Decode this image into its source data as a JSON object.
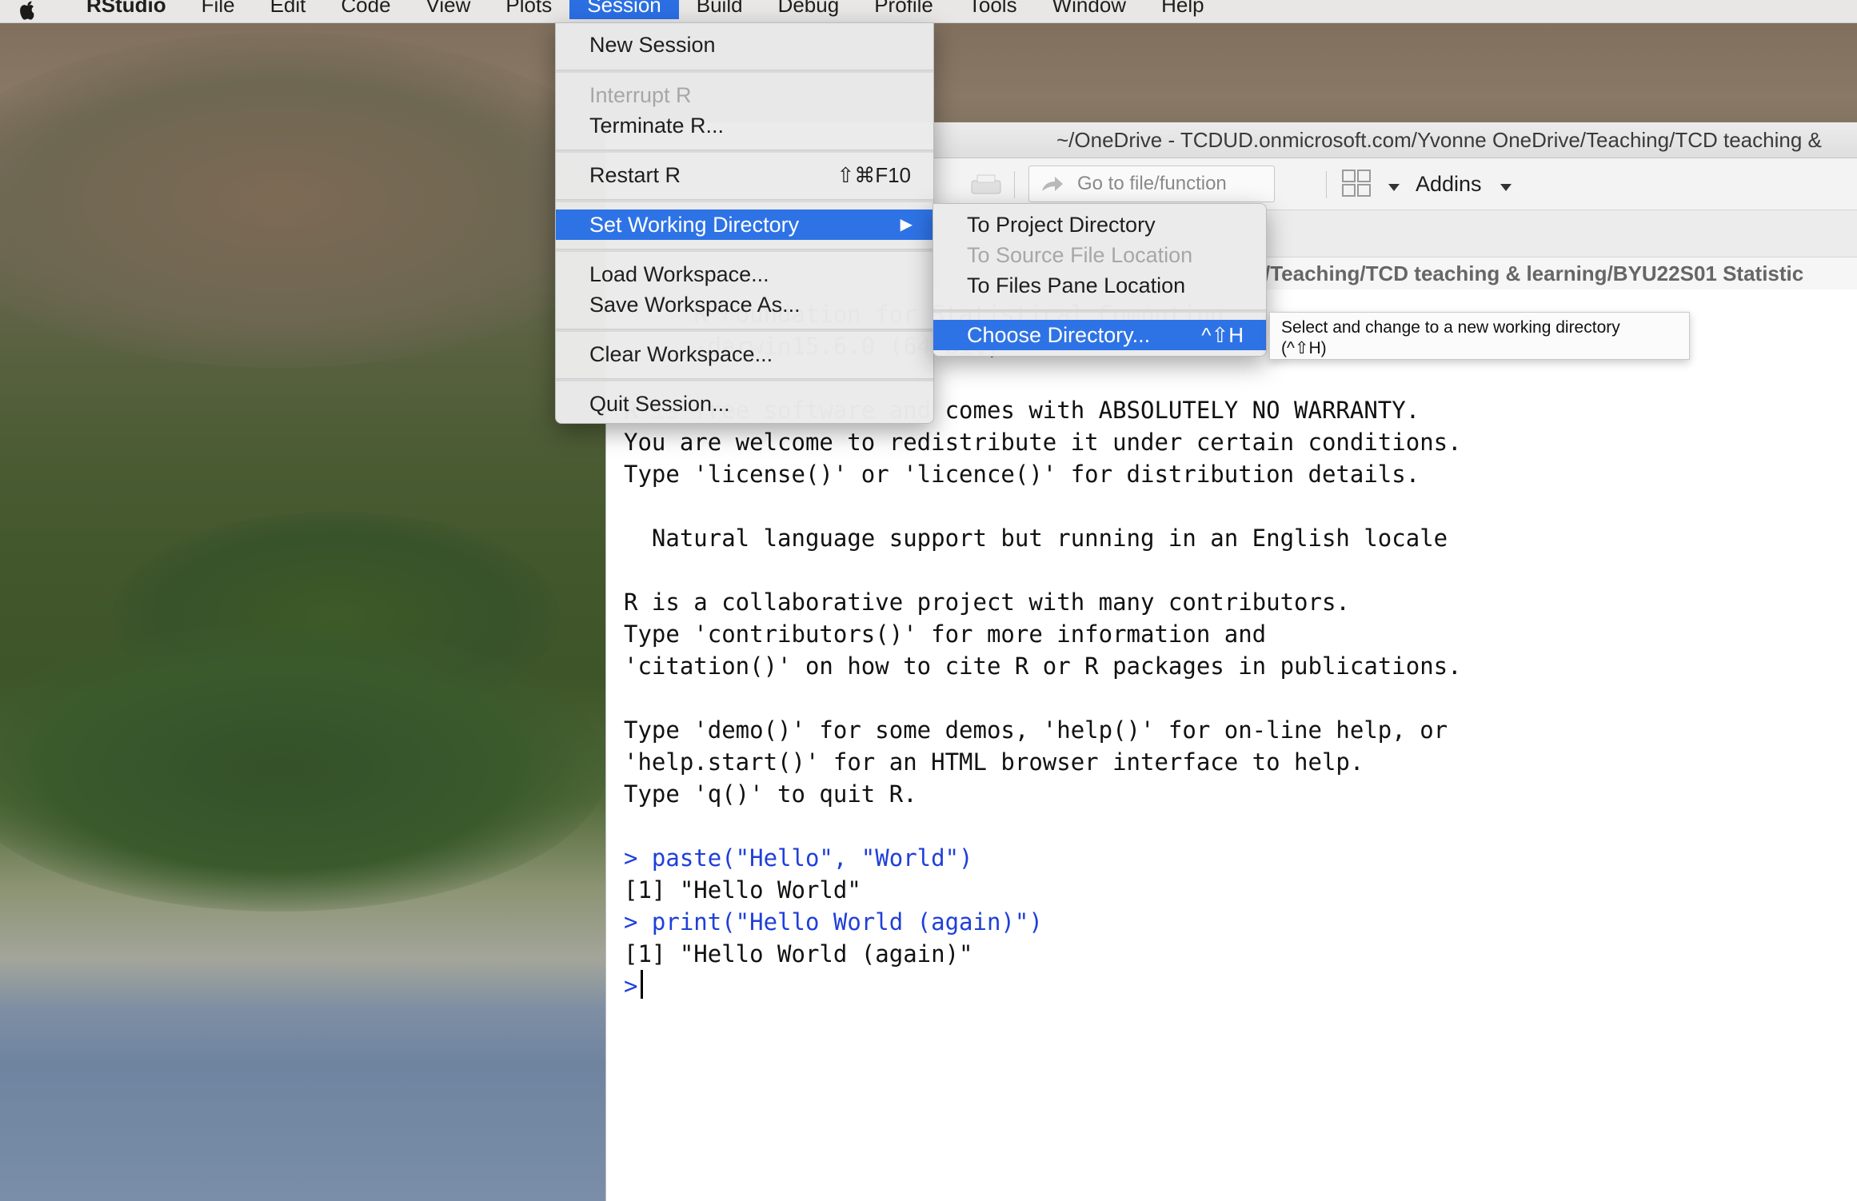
{
  "menubar": {
    "app_name": "RStudio",
    "items": [
      "File",
      "Edit",
      "Code",
      "View",
      "Plots",
      "Session",
      "Build",
      "Debug",
      "Profile",
      "Tools",
      "Window",
      "Help"
    ],
    "active": "Session"
  },
  "window": {
    "title": "~/OneDrive - TCDUD.onmicrosoft.com/Yvonne OneDrive/Teaching/TCD teaching &",
    "toolbar": {
      "goto_placeholder": "Go to file/function",
      "addins_label": "Addins"
    },
    "console_path": "/Teaching/TCD teaching & learning/BYU22S01 Statistic"
  },
  "console": {
    "lines": [
      {
        "text": "R Foundation for Statistical Computing",
        "type": "output",
        "indent": "     "
      },
      {
        "text": "-darwin15.6.0 (64-bit)",
        "type": "output",
        "indent": "     "
      },
      {
        "text": "",
        "type": "blank"
      },
      {
        "text": "R is free software and comes with ABSOLUTELY NO WARRANTY.",
        "type": "output"
      },
      {
        "text": "You are welcome to redistribute it under certain conditions.",
        "type": "output"
      },
      {
        "text": "Type 'license()' or 'licence()' for distribution details.",
        "type": "output"
      },
      {
        "text": "",
        "type": "blank"
      },
      {
        "text": "  Natural language support but running in an English locale",
        "type": "output"
      },
      {
        "text": "",
        "type": "blank"
      },
      {
        "text": "R is a collaborative project with many contributors.",
        "type": "output"
      },
      {
        "text": "Type 'contributors()' for more information and",
        "type": "output"
      },
      {
        "text": "'citation()' on how to cite R or R packages in publications.",
        "type": "output"
      },
      {
        "text": "",
        "type": "blank"
      },
      {
        "text": "Type 'demo()' for some demos, 'help()' for on-line help, or",
        "type": "output"
      },
      {
        "text": "'help.start()' for an HTML browser interface to help.",
        "type": "output"
      },
      {
        "text": "Type 'q()' to quit R.",
        "type": "output"
      },
      {
        "text": "",
        "type": "blank"
      },
      {
        "text": "> paste(\"Hello\", \"World\")",
        "type": "cmd"
      },
      {
        "text": "[1] \"Hello World\"",
        "type": "output"
      },
      {
        "text": "> print(\"Hello World (again)\")",
        "type": "cmd"
      },
      {
        "text": "[1] \"Hello World (again)\"",
        "type": "output"
      }
    ],
    "prompt": ">"
  },
  "session_menu": {
    "new_session": "New Session",
    "interrupt": "Interrupt R",
    "terminate": "Terminate R...",
    "restart": "Restart R",
    "restart_shortcut": "⇧⌘F10",
    "set_wd": "Set Working Directory",
    "load_ws": "Load Workspace...",
    "save_ws": "Save Workspace As...",
    "clear_ws": "Clear Workspace...",
    "quit": "Quit Session..."
  },
  "wd_submenu": {
    "project": "To Project Directory",
    "source": "To Source File Location",
    "files_pane": "To Files Pane Location",
    "choose": "Choose Directory...",
    "choose_shortcut": "^⇧H"
  },
  "tooltip": {
    "line1": "Select and change to a new working directory",
    "line2": "(^⇧H)"
  },
  "colors": {
    "menu_highlight": "#2e73e6",
    "console_command": "#1f3fd9"
  }
}
